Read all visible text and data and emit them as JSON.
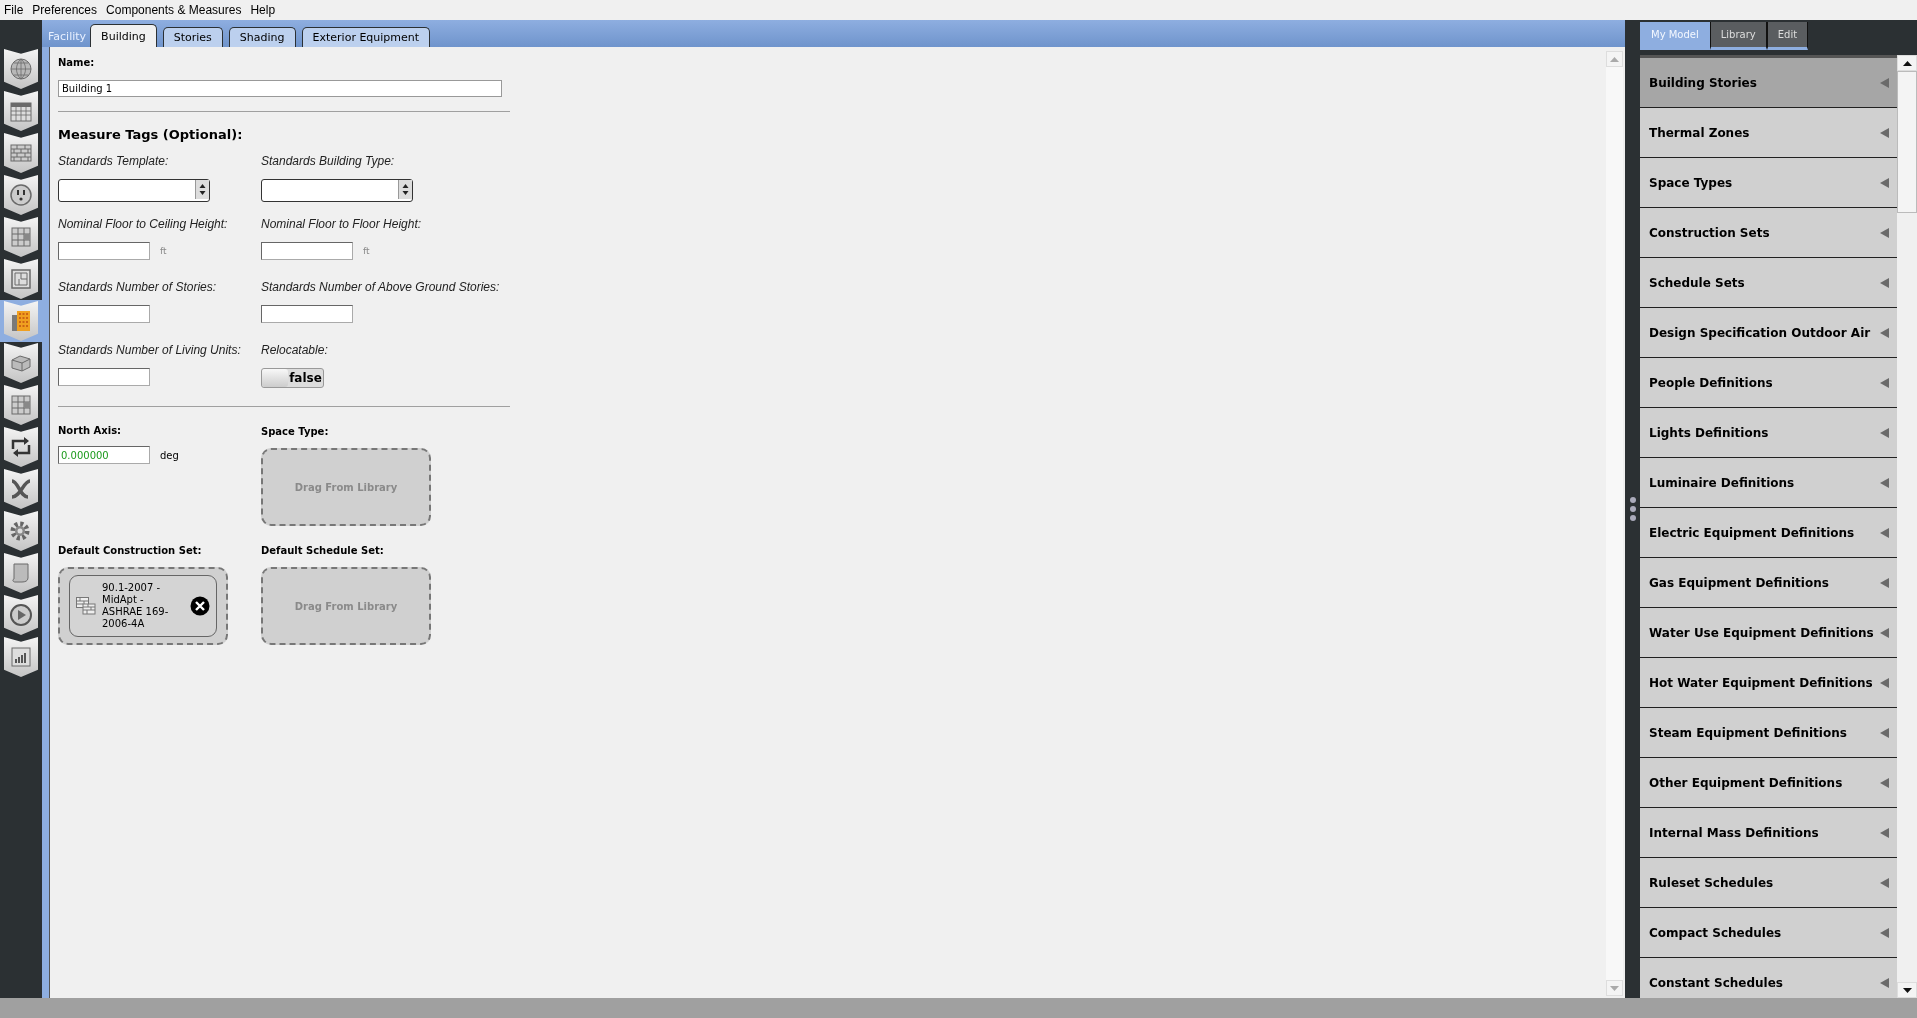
{
  "menu_bar": [
    "File",
    "Preferences",
    "Components & Measures",
    "Help"
  ],
  "sidebar": {
    "items": [
      {
        "selected": false
      },
      {
        "selected": false
      },
      {
        "selected": false
      },
      {
        "selected": false
      },
      {
        "selected": false
      },
      {
        "selected": false
      },
      {
        "selected": true
      },
      {
        "selected": false
      },
      {
        "selected": false
      },
      {
        "selected": false
      },
      {
        "selected": false
      },
      {
        "selected": false
      },
      {
        "selected": false
      },
      {
        "selected": false
      },
      {
        "selected": false
      }
    ]
  },
  "header": {
    "title": "Facility",
    "tabs": [
      {
        "label": "Building",
        "selected": true
      },
      {
        "label": "Stories",
        "selected": false
      },
      {
        "label": "Shading",
        "selected": false
      },
      {
        "label": "Exterior Equipment",
        "selected": false
      }
    ]
  },
  "form": {
    "name": {
      "label": "Name:",
      "value": "Building 1"
    },
    "section_title": "Measure Tags (Optional):",
    "fields": [
      {
        "kind": "combo",
        "label": "Standards Template:"
      },
      {
        "kind": "combo",
        "label": "Standards Building Type:"
      },
      {
        "kind": "unit",
        "label": "Nominal Floor to Ceiling Height:",
        "unit": "ft"
      },
      {
        "kind": "unit",
        "label": "Nominal Floor to Floor Height:",
        "unit": "ft"
      },
      {
        "kind": "text",
        "label": "Standards Number of Stories:"
      },
      {
        "kind": "text",
        "label": "Standards Number of Above Ground Stories:"
      },
      {
        "kind": "text",
        "label": "Standards Number of Living Units:"
      },
      {
        "kind": "toggle",
        "label": "Relocatable:",
        "value": "false",
        "on": false
      }
    ],
    "north_axis": {
      "label": "North Axis:",
      "value": "0.000000",
      "unit": "deg"
    },
    "space_type": {
      "label": "Space Type:",
      "hint": "Drag From Library"
    },
    "construction_set": {
      "label": "Default Construction Set:",
      "item": "90.1-2007 - MidApt - ASHRAE 169-2006-4A"
    },
    "schedule_set": {
      "label": "Default Schedule Set:",
      "hint": "Drag From Library"
    }
  },
  "right_panel": {
    "tabs": [
      {
        "label": "My Model",
        "selected": true
      },
      {
        "label": "Library",
        "selected": false
      },
      {
        "label": "Edit",
        "selected": false
      }
    ],
    "items": [
      {
        "label": "Building Stories",
        "selected": true
      },
      {
        "label": "Thermal Zones",
        "selected": false
      },
      {
        "label": "Space Types",
        "selected": false
      },
      {
        "label": "Construction Sets",
        "selected": false
      },
      {
        "label": "Schedule Sets",
        "selected": false
      },
      {
        "label": "Design Specification Outdoor Air",
        "selected": false
      },
      {
        "label": "People Definitions",
        "selected": false
      },
      {
        "label": "Lights Definitions",
        "selected": false
      },
      {
        "label": "Luminaire Definitions",
        "selected": false
      },
      {
        "label": "Electric Equipment Definitions",
        "selected": false
      },
      {
        "label": "Gas Equipment Definitions",
        "selected": false
      },
      {
        "label": "Water Use Equipment Definitions",
        "selected": false
      },
      {
        "label": "Hot Water Equipment Definitions",
        "selected": false
      },
      {
        "label": "Steam Equipment Definitions",
        "selected": false
      },
      {
        "label": "Other Equipment Definitions",
        "selected": false
      },
      {
        "label": "Internal Mass Definitions",
        "selected": false
      },
      {
        "label": "Ruleset Schedules",
        "selected": false
      },
      {
        "label": "Compact Schedules",
        "selected": false
      },
      {
        "label": "Constant Schedules",
        "selected": false
      }
    ]
  }
}
